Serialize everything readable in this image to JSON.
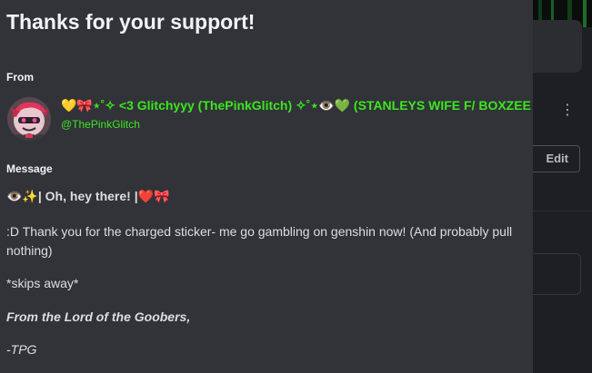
{
  "modal": {
    "title": "Thanks for your support!",
    "from_label": "From",
    "message_label": "Message"
  },
  "sender": {
    "display_name": "💛🎀⋆˚✧ <3 Glitchyyy (ThePinkGlitch) ✧˚⋆👁️💚 (STANLEYS WIFE F/ BOXZEE 🌞",
    "handle": "@ThePinkGlitch",
    "name_color": "#3be61f"
  },
  "message": {
    "greeting": "👁️✨| Oh, hey there! |❤️🎀",
    "body": ":D Thank you for the charged sticker- me go gambling on genshin now! (And probably pull nothing)",
    "action": "*skips away*",
    "signoff": "From the Lord of the Goobers,",
    "signature": "-TPG"
  },
  "background": {
    "edit_label": "Edit"
  }
}
